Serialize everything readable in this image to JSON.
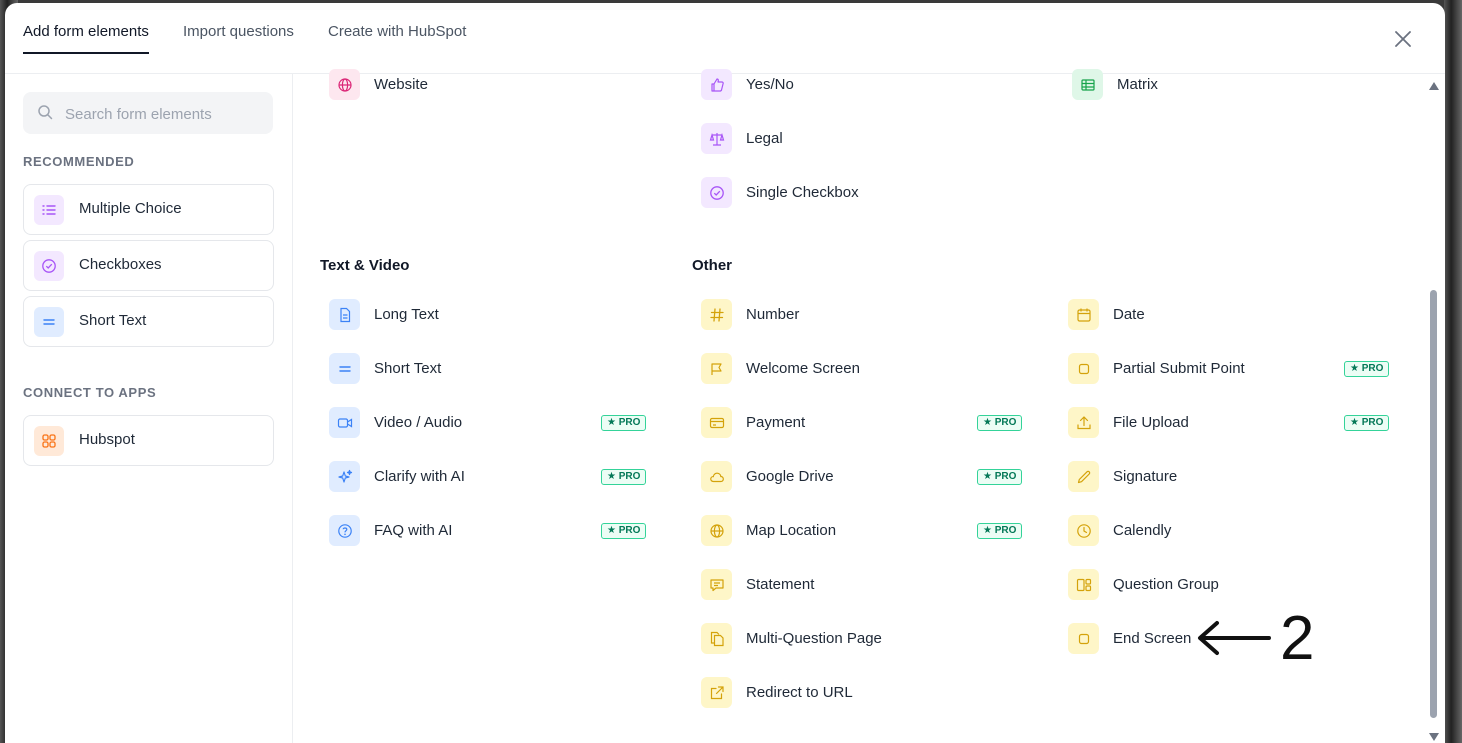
{
  "tabs": [
    {
      "label": "Add form elements",
      "active": true
    },
    {
      "label": "Import questions",
      "active": false
    },
    {
      "label": "Create with HubSpot",
      "active": false
    }
  ],
  "search": {
    "placeholder": "Search form elements"
  },
  "sidebar": {
    "recommended_title": "RECOMMENDED",
    "recommended": [
      {
        "label": "Multiple Choice",
        "icon": "list-icon"
      },
      {
        "label": "Checkboxes",
        "icon": "check-circle-icon"
      },
      {
        "label": "Short Text",
        "icon": "short-text-icon"
      }
    ],
    "apps_title": "CONNECT TO APPS",
    "apps": [
      {
        "label": "Hubspot",
        "icon": "apps-grid-icon"
      }
    ]
  },
  "top_rows": {
    "col1": [
      {
        "label": "Website"
      }
    ],
    "col2": [
      {
        "label": "Yes/No"
      },
      {
        "label": "Legal"
      },
      {
        "label": "Single Checkbox"
      }
    ],
    "col3": [
      {
        "label": "Matrix"
      }
    ]
  },
  "groups": {
    "text_video": {
      "title": "Text & Video",
      "items": [
        {
          "label": "Long Text",
          "pro": false
        },
        {
          "label": "Short Text",
          "pro": false
        },
        {
          "label": "Video / Audio",
          "pro": true
        },
        {
          "label": "Clarify with AI",
          "pro": true
        },
        {
          "label": "FAQ with AI",
          "pro": true
        }
      ]
    },
    "other": {
      "title": "Other",
      "col1": [
        {
          "label": "Number",
          "pro": false
        },
        {
          "label": "Welcome Screen",
          "pro": false
        },
        {
          "label": "Payment",
          "pro": true
        },
        {
          "label": "Google Drive",
          "pro": true
        },
        {
          "label": "Map Location",
          "pro": true
        },
        {
          "label": "Statement",
          "pro": false
        },
        {
          "label": "Multi-Question Page",
          "pro": false
        },
        {
          "label": "Redirect to URL",
          "pro": false
        }
      ],
      "col2": [
        {
          "label": "Date",
          "pro": false
        },
        {
          "label": "Partial Submit Point",
          "pro": true
        },
        {
          "label": "File Upload",
          "pro": true
        },
        {
          "label": "Signature",
          "pro": false
        },
        {
          "label": "Calendly",
          "pro": false
        },
        {
          "label": "Question Group",
          "pro": false
        },
        {
          "label": "End Screen",
          "pro": false
        }
      ]
    }
  },
  "pro_label": "★ PRO",
  "annotation": {
    "number": "2"
  },
  "colors": {
    "purple": "#a855f7",
    "blue": "#3b82f6",
    "yellow": "#d4a20a",
    "pink": "#db2777",
    "green": "#16a34a",
    "orange": "#f97316"
  }
}
